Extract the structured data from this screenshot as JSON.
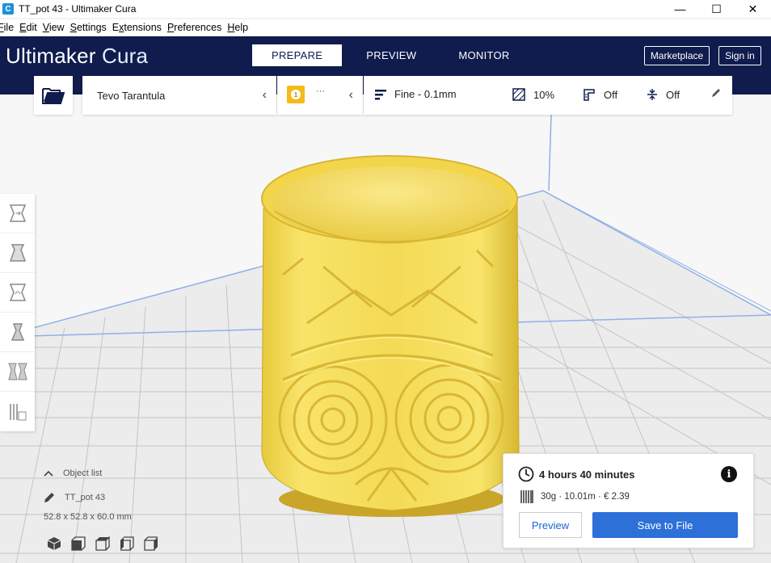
{
  "window": {
    "title": "TT_pot 43  - Ultimaker Cura",
    "app_icon_letter": "C",
    "minimize": "—",
    "maximize": "☐",
    "close": "✕"
  },
  "menu": {
    "items": [
      {
        "label": "File",
        "accel": "F"
      },
      {
        "label": "Edit",
        "accel": "E"
      },
      {
        "label": "View",
        "accel": "V"
      },
      {
        "label": "Settings",
        "accel": "S"
      },
      {
        "label": "Extensions",
        "accel": "x"
      },
      {
        "label": "Preferences",
        "accel": "P"
      },
      {
        "label": "Help",
        "accel": "H"
      }
    ]
  },
  "header": {
    "logo_main": "Ultimaker",
    "logo_sub": "Cura",
    "tabs": [
      {
        "label": "PREPARE",
        "active": true
      },
      {
        "label": "PREVIEW",
        "active": false
      },
      {
        "label": "MONITOR",
        "active": false
      }
    ],
    "marketplace": "Marketplace",
    "signin": "Sign in"
  },
  "toolbar": {
    "printer": "Tevo Tarantula",
    "extruder_number": "1",
    "material": "···",
    "profile": "Fine - 0.1mm",
    "infill": "10%",
    "support": "Off",
    "adhesion": "Off"
  },
  "tools": [
    {
      "name": "move-tool-icon"
    },
    {
      "name": "scale-tool-icon"
    },
    {
      "name": "rotate-tool-icon"
    },
    {
      "name": "mirror-tool-icon"
    },
    {
      "name": "per-model-settings-icon"
    },
    {
      "name": "support-blocker-icon"
    }
  ],
  "object_list": {
    "header": "Object list",
    "object_name": "TT_pot 43",
    "dimensions": "52.8 x 52.8 x 60.0 mm"
  },
  "print_info": {
    "time": "4 hours 40 minutes",
    "material_summary": "30g · 10.01m · € 2.39",
    "preview_label": "Preview",
    "save_label": "Save to File"
  },
  "colors": {
    "header_bg": "#0f1c4d",
    "accent_blue": "#2d70d8",
    "model_yellow": "#f7e15a",
    "extruder_badge": "#f3ba1a"
  }
}
